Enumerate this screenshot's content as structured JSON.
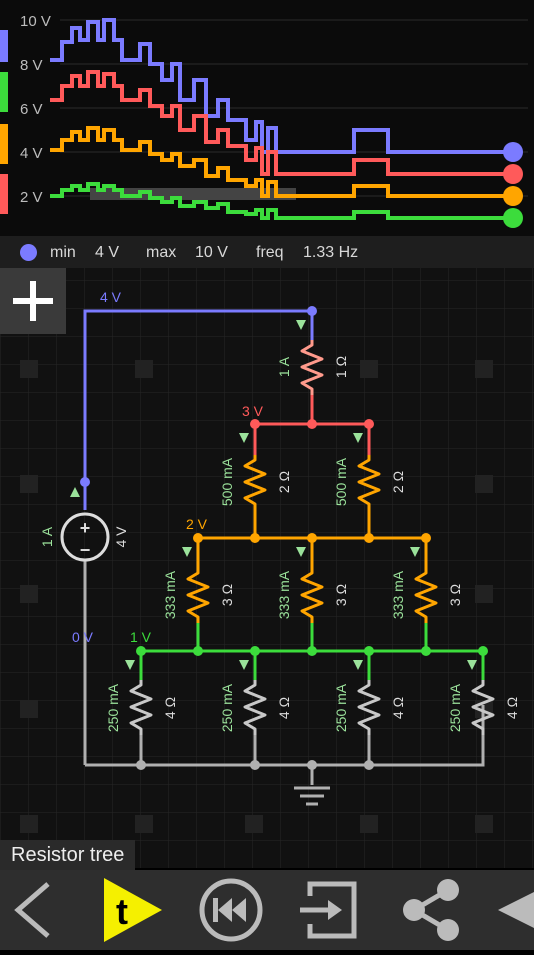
{
  "scope": {
    "axis_labels": [
      "10 V",
      "8 V",
      "6 V",
      "4 V",
      "2 V"
    ],
    "channels": [
      {
        "color": "#7b7bff"
      },
      {
        "color": "#ff5a5a"
      },
      {
        "color": "#ffa500"
      },
      {
        "color": "#3cdc3c"
      }
    ]
  },
  "info": {
    "min_label": "min",
    "min_value": "4 V",
    "max_label": "max",
    "max_value": "10 V",
    "freq_label": "freq",
    "freq_value": "1.33 Hz"
  },
  "circuit": {
    "node_voltages": {
      "top": "4 V",
      "n3": "3 V",
      "n2": "2 V",
      "n1": "1 V",
      "ground": "0 V"
    },
    "source": {
      "current": "1 A",
      "voltage": "4 V"
    },
    "resistors": {
      "r1": {
        "current": "1 A",
        "resistance": "1 Ω"
      },
      "r2a": {
        "current": "500 mA",
        "resistance": "2 Ω"
      },
      "r2b": {
        "current": "500 mA",
        "resistance": "2 Ω"
      },
      "r3a": {
        "current": "333 mA",
        "resistance": "3 Ω"
      },
      "r3b": {
        "current": "333 mA",
        "resistance": "3 Ω"
      },
      "r3c": {
        "current": "333 mA",
        "resistance": "3 Ω"
      },
      "r4a": {
        "current": "250 mA",
        "resistance": "4 Ω"
      },
      "r4b": {
        "current": "250 mA",
        "resistance": "4 Ω"
      },
      "r4c": {
        "current": "250 mA",
        "resistance": "4 Ω"
      },
      "r4d": {
        "current": "250 mA",
        "resistance": "4 Ω"
      }
    },
    "colors": {
      "blue": "#7b7bff",
      "red": "#ff5a5a",
      "orange": "#ffa500",
      "green": "#3cdc3c",
      "gray": "#b0b0b0"
    }
  },
  "title": "Resistor tree",
  "toolbar": {
    "back": "back-icon",
    "play": "t",
    "rewind": "rewind-icon",
    "import": "import-icon",
    "share": "share-icon",
    "next": "next-icon"
  }
}
